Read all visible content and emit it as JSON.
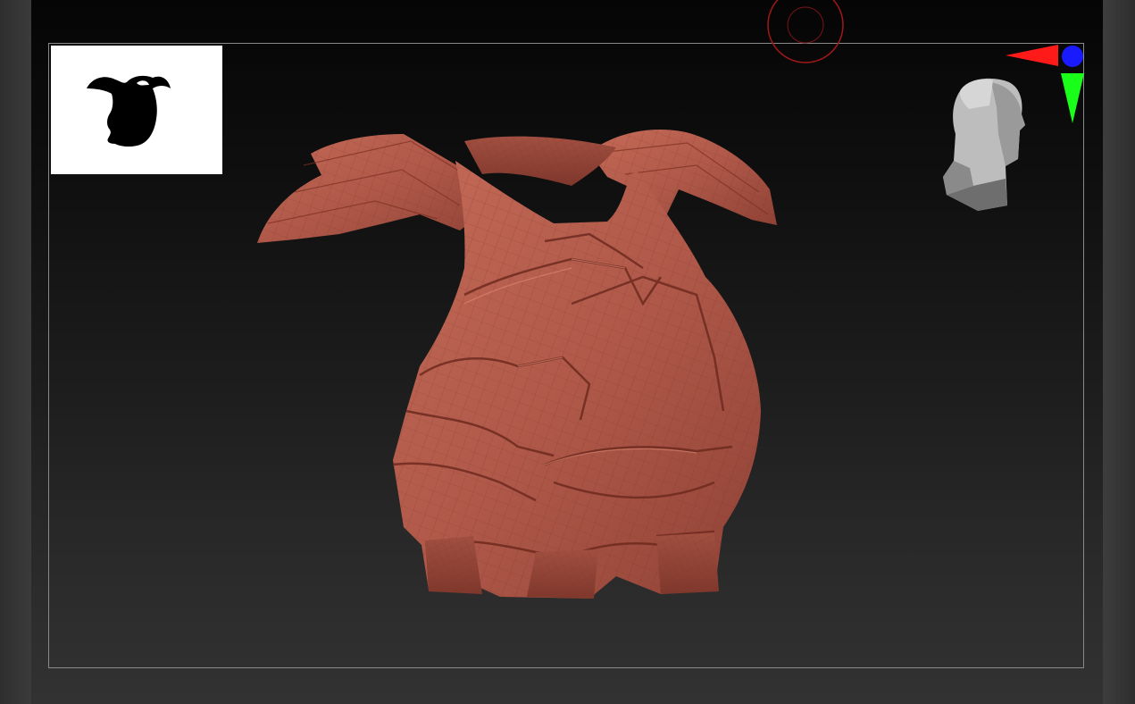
{
  "app": {
    "viewport_label": "3D viewport"
  },
  "viewport": {
    "background_top": "#050505",
    "background_bottom": "#323232",
    "frame_color": "#8a8a8a"
  },
  "model": {
    "material_color": "#b35d4b",
    "wire_color": "#7a2f22",
    "icon": "armor-mesh"
  },
  "thumbnail": {
    "icon": "silhouette-thumbnail",
    "background": "#ffffff",
    "fill": "#000000"
  },
  "gizmo": {
    "x_axis_color": "#ff1a1a",
    "y_axis_color": "#1aff1a",
    "z_axis_color": "#1a1aff",
    "head_icon": "orientation-head-icon"
  },
  "focal_ring": {
    "color": "#b31a1a",
    "icon": "focal-ring-icon"
  }
}
